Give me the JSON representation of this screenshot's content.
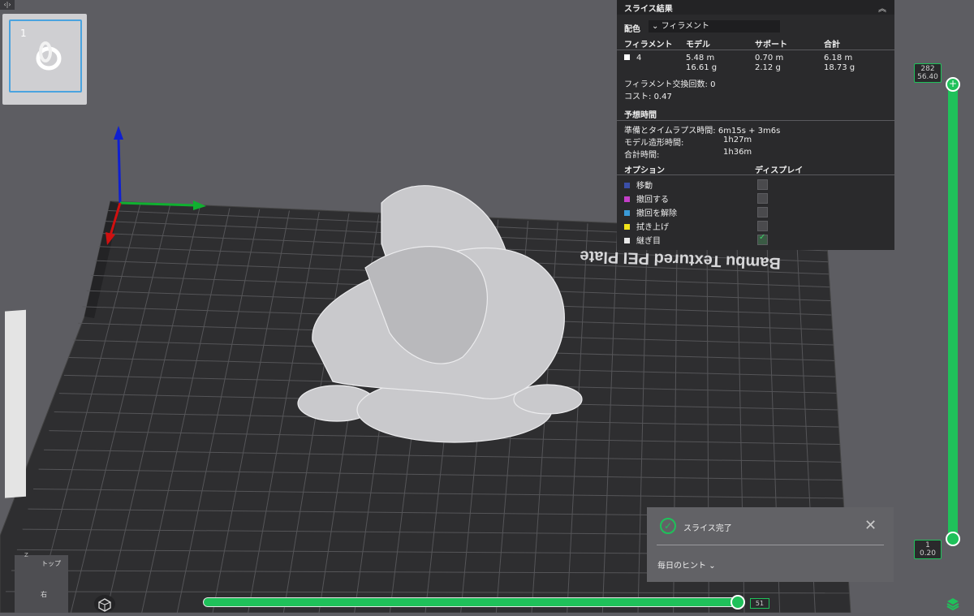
{
  "thumbnail": {
    "plate_number": "1"
  },
  "slice_panel": {
    "title": "スライス結果",
    "color_scheme_label": "配色",
    "color_scheme_value": "フィラメント",
    "table_headers": [
      "フィラメント",
      "モデル",
      "サポート",
      "合計"
    ],
    "filament_rows": [
      {
        "id": "4",
        "color": "#ffffff",
        "model_length": "5.48 m",
        "model_weight": "16.61 g",
        "support_length": "0.70 m",
        "support_weight": "2.12 g",
        "total_length": "6.18 m",
        "total_weight": "18.73 g"
      }
    ],
    "filament_changes_label": "フィラメント交換回数:",
    "filament_changes_value": "0",
    "cost_label": "コスト:",
    "cost_value": "0.47",
    "estimated_time_title": "予想時間",
    "time_rows": [
      {
        "label": "準備とタイムラプス時間:",
        "value": "6m15s + 3m6s"
      },
      {
        "label": "モデル造形時間:",
        "value": "1h27m"
      },
      {
        "label": "合計時間:",
        "value": "1h36m"
      }
    ],
    "options_header": "オプション",
    "display_header": "ディスプレイ",
    "options": [
      {
        "label": "移動",
        "color": "#3b4fa8",
        "checked": false
      },
      {
        "label": "撤回する",
        "color": "#c43fc8",
        "checked": false
      },
      {
        "label": "撤回を解除",
        "color": "#3a9ad8",
        "checked": false
      },
      {
        "label": "拭き上げ",
        "color": "#f0e21a",
        "checked": false
      },
      {
        "label": "継ぎ目",
        "color": "#e8e8e8",
        "checked": true
      }
    ]
  },
  "layer_slider": {
    "top_layer": "282",
    "top_height": "56.40",
    "bottom_layer": "1",
    "bottom_height": "0.20",
    "accent_color": "#1fc15a"
  },
  "move_slider": {
    "value": "51"
  },
  "plate_label": "Bambu Textured PEI Plate",
  "notification": {
    "title": "スライス完了",
    "hint_label": "毎日のヒント"
  },
  "view_cube": {
    "top_label": "トップ",
    "right_label": "右",
    "z_label": "Z"
  }
}
